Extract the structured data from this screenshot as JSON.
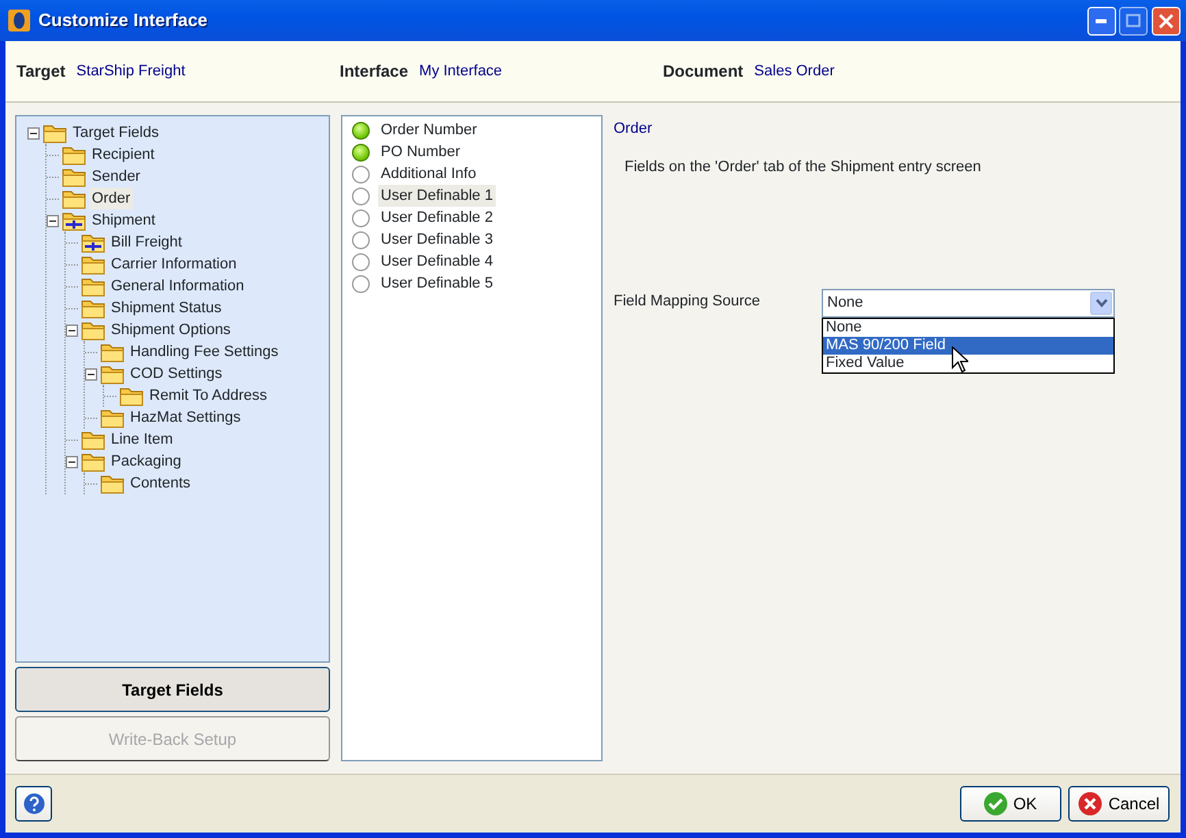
{
  "window": {
    "title": "Customize Interface"
  },
  "header": [
    {
      "label": "Target",
      "value": "StarShip Freight"
    },
    {
      "label": "Interface",
      "value": "My Interface"
    },
    {
      "label": "Document",
      "value": "Sales Order"
    }
  ],
  "tree": [
    {
      "label": "Target Fields",
      "kind": "folder",
      "expanded": true,
      "selected": false,
      "children": [
        {
          "label": "Recipient",
          "kind": "folder",
          "selected": false
        },
        {
          "label": "Sender",
          "kind": "folder",
          "selected": false
        },
        {
          "label": "Order",
          "kind": "folder",
          "selected": true
        },
        {
          "label": "Shipment",
          "kind": "cross",
          "expanded": true,
          "selected": false,
          "children": [
            {
              "label": "Bill Freight",
              "kind": "cross",
              "selected": false
            },
            {
              "label": "Carrier Information",
              "kind": "folder",
              "selected": false
            },
            {
              "label": "General Information",
              "kind": "folder",
              "selected": false
            },
            {
              "label": "Shipment Status",
              "kind": "folder",
              "selected": false
            },
            {
              "label": "Shipment Options",
              "kind": "folder",
              "expanded": true,
              "selected": false,
              "children": [
                {
                  "label": "Handling Fee Settings",
                  "kind": "folder",
                  "selected": false
                },
                {
                  "label": "COD Settings",
                  "kind": "folder",
                  "expanded": true,
                  "selected": false,
                  "children": [
                    {
                      "label": "Remit To Address",
                      "kind": "folder",
                      "selected": false
                    }
                  ]
                },
                {
                  "label": "HazMat Settings",
                  "kind": "folder",
                  "selected": false
                }
              ]
            },
            {
              "label": "Line Item",
              "kind": "folder",
              "selected": false
            },
            {
              "label": "Packaging",
              "kind": "folder",
              "expanded": true,
              "selected": false,
              "children": [
                {
                  "label": "Contents",
                  "kind": "folder",
                  "selected": false
                }
              ]
            }
          ]
        }
      ]
    }
  ],
  "nav_buttons": [
    {
      "label": "Target Fields",
      "selected": true,
      "disabled": false
    },
    {
      "label": "Write-Back Setup",
      "selected": false,
      "disabled": true
    }
  ],
  "fields": [
    {
      "label": "Order Number",
      "mapped": true,
      "selected": false
    },
    {
      "label": "PO Number",
      "mapped": true,
      "selected": false
    },
    {
      "label": "Additional Info",
      "mapped": false,
      "selected": false
    },
    {
      "label": "User Definable 1",
      "mapped": false,
      "selected": true
    },
    {
      "label": "User Definable 2",
      "mapped": false,
      "selected": false
    },
    {
      "label": "User Definable 3",
      "mapped": false,
      "selected": false
    },
    {
      "label": "User Definable 4",
      "mapped": false,
      "selected": false
    },
    {
      "label": "User Definable 5",
      "mapped": false,
      "selected": false
    }
  ],
  "detail": {
    "title": "Order",
    "description": "Fields on the 'Order' tab of the Shipment entry screen",
    "mapping_label": "Field Mapping Source",
    "mapping_value": "None",
    "options": [
      {
        "label": "None",
        "selected": false
      },
      {
        "label": "MAS 90/200 Field",
        "selected": true
      },
      {
        "label": "Fixed Value",
        "selected": false
      }
    ]
  },
  "footer": {
    "ok": "OK",
    "cancel": "Cancel"
  }
}
